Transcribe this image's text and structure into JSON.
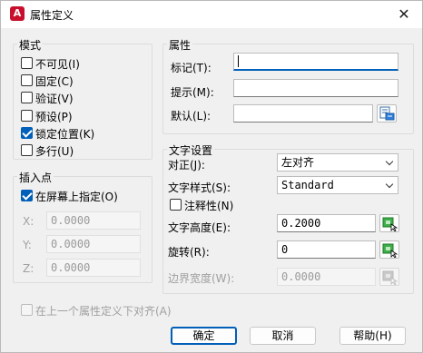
{
  "window": {
    "title": "属性定义",
    "app_icon_letter": "A",
    "close_glyph": "✕"
  },
  "mode": {
    "title": "模式",
    "options": [
      {
        "label": "不可见(I)",
        "checked": false
      },
      {
        "label": "固定(C)",
        "checked": false
      },
      {
        "label": "验证(V)",
        "checked": false
      },
      {
        "label": "预设(P)",
        "checked": false
      },
      {
        "label": "锁定位置(K)",
        "checked": true
      },
      {
        "label": "多行(U)",
        "checked": false
      }
    ]
  },
  "insert_point": {
    "title": "插入点",
    "specify_on_screen": {
      "label": "在屏幕上指定(O)",
      "checked": true
    },
    "x": {
      "label": "X:",
      "value": "0.0000"
    },
    "y": {
      "label": "Y:",
      "value": "0.0000"
    },
    "z": {
      "label": "Z:",
      "value": "0.0000"
    }
  },
  "attribute": {
    "title": "属性",
    "tag": {
      "label": "标记(T):",
      "value": ""
    },
    "prompt": {
      "label": "提示(M):",
      "value": ""
    },
    "default": {
      "label": "默认(L):",
      "value": ""
    }
  },
  "text_settings": {
    "title": "文字设置",
    "justification": {
      "label": "对正(J):",
      "value": "左对齐"
    },
    "text_style": {
      "label": "文字样式(S):",
      "value": "Standard"
    },
    "annotative": {
      "label": "注释性(N)",
      "checked": false
    },
    "text_height": {
      "label": "文字高度(E):",
      "value": "0.2000"
    },
    "rotation": {
      "label": "旋转(R):",
      "value": "0"
    },
    "boundary_width": {
      "label": "边界宽度(W):",
      "value": "0.0000"
    }
  },
  "align_below": {
    "label": "在上一个属性定义下对齐(A)",
    "checked": false
  },
  "buttons": {
    "ok": "确定",
    "cancel": "取消",
    "help": "帮助(H)"
  },
  "colors": {
    "accent": "#005fb8",
    "app_icon": "#c8102e"
  }
}
